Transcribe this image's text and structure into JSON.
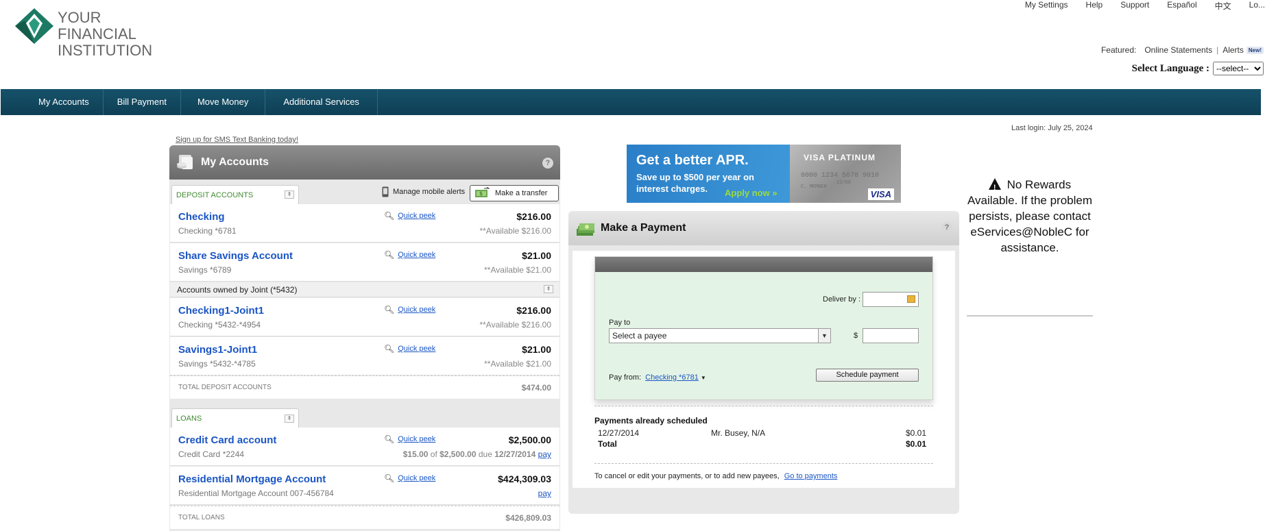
{
  "header": {
    "logo_line1": "YOUR FINANCIAL",
    "logo_line2": "INSTITUTION",
    "util_nav": [
      "My Settings",
      "Help",
      "Support",
      "Español",
      "中文",
      "Lo..."
    ],
    "featured_label": "Featured:",
    "featured_links": [
      "Online Statements",
      "Alerts"
    ],
    "new_badge": "New!",
    "language_label": "Select Language :",
    "language_value": "--select--"
  },
  "nav": {
    "items": [
      "My Accounts",
      "Bill Payment",
      "Move Money",
      "Additional Services"
    ]
  },
  "last_login": "Last login: July 25, 2024",
  "sms_link": "Sign up for SMS Text Banking today!",
  "accounts_panel": {
    "title": "My Accounts",
    "deposit_tab": "DEPOSIT ACCOUNTS",
    "manage_mobile": "Manage mobile alerts",
    "transfer_button": "Make a transfer",
    "peek_label": "Quick peek",
    "deposit": [
      {
        "name": "Checking",
        "sub": "Checking *6781",
        "balance": "$216.00",
        "available": "**Available $216.00"
      },
      {
        "name": "Share Savings Account",
        "sub": "Savings *6789",
        "balance": "$21.00",
        "available": "**Available $21.00"
      }
    ],
    "joint_label": "Accounts owned by Joint (*5432)",
    "joint": [
      {
        "name": "Checking1-Joint1",
        "sub": "Checking *5432-*4954",
        "balance": "$216.00",
        "available": "**Available $216.00"
      },
      {
        "name": "Savings1-Joint1",
        "sub": "Savings *5432-*4785",
        "balance": "$21.00",
        "available": "**Available $21.00"
      }
    ],
    "total_deposit_label": "TOTAL DEPOSIT ACCOUNTS",
    "total_deposit": "$474.00",
    "loans_tab": "LOANS",
    "loans": [
      {
        "name": "Credit Card account",
        "sub": "Credit Card *2244",
        "balance": "$2,500.00",
        "due_amount": "$15.00",
        "of": "of",
        "due_total": "$2,500.00",
        "due": "due",
        "due_date": "12/27/2014",
        "pay": "pay"
      },
      {
        "name": "Residential Mortgage Account",
        "sub": "Residential Mortgage Account 007-456784",
        "balance": "$424,309.03",
        "pay": "pay"
      }
    ],
    "total_loans_label": "TOTAL LOANS",
    "total_loans": "$426,809.03"
  },
  "ad": {
    "headline": "Get a better APR.",
    "body": "Save up to $500 per year on interest charges.",
    "cta": "Apply now »",
    "card_brand": "VISA PLATINUM",
    "card_number": "0000 1234 5678 9010",
    "card_holder": "C. MEMBER",
    "card_date": "12/06",
    "visa": "VISA"
  },
  "payment": {
    "title": "Make a Payment",
    "deliver_by_label": "Deliver by :",
    "deliver_by_value": "",
    "pay_to_label": "Pay to",
    "payee_value": "Select a payee",
    "currency": "$",
    "amount_value": "",
    "pay_from_label": "Pay from:",
    "pay_from_value": "Checking *6781",
    "schedule_button": "Schedule payment",
    "scheduled_heading": "Payments already scheduled",
    "scheduled": [
      {
        "date": "12/27/2014",
        "payee": "Mr. Busey, N/A",
        "amount": "$0.01"
      }
    ],
    "total_label": "Total",
    "total_amount": "$0.01",
    "footer_text": "To cancel or edit your payments, or to add new payees,",
    "footer_link": "Go to payments"
  },
  "rewards": {
    "message": "No Rewards Available. If the problem persists, please contact eServices@NobleC for assistance."
  },
  "colors": {
    "nav_bg": "#0e3f55",
    "link": "#1a55c4",
    "brand_green": "#1d7a64",
    "form_bg": "#e3f3e5"
  }
}
